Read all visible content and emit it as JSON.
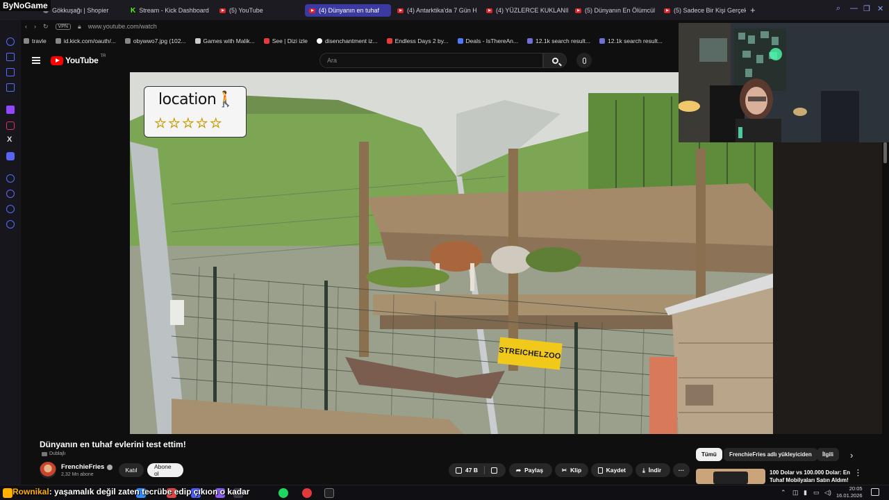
{
  "overlay": {
    "stream_logo": "ByNoGame"
  },
  "browser": {
    "tabs": [
      {
        "label": "Gökkuşağı | Shopier",
        "icon": "shopier-icon"
      },
      {
        "label": "Stream - Kick Dashboard",
        "icon": "kick-icon"
      },
      {
        "label": "(5) YouTube",
        "icon": "youtube-icon"
      },
      {
        "label": "(4) Dünyanın en tuhaf",
        "icon": "youtube-icon",
        "active": true
      },
      {
        "label": "(4) Antarktika'da 7 Gün H",
        "icon": "youtube-icon"
      },
      {
        "label": "(4) YÜZLERCE KUKLANIN",
        "icon": "youtube-icon"
      },
      {
        "label": "(5) Dünyanın En Ölümcül K",
        "icon": "youtube-icon"
      },
      {
        "label": "(5) Sadece Bir Kişi Gerçek",
        "icon": "youtube-icon"
      }
    ],
    "new_tab": "+",
    "address": {
      "vpn": "VPN",
      "url": "www.youtube.com/watch"
    },
    "bookmarks": [
      "travle",
      "id.kick.com/oauth/...",
      "obywwo7.jpg (102...",
      "Games with Malik...",
      "See | Dizi izle",
      "disenchantment iz...",
      "Endless Days 2 by...",
      "Deals - IsThereAn...",
      "12.1k search result...",
      "12.1k search result..."
    ]
  },
  "youtube": {
    "logo": "YouTube",
    "region": "TR",
    "search_placeholder": "Ara",
    "video": {
      "overlay_title": "location🚶",
      "overlay_stars": "☆☆☆☆☆",
      "sign_text": "STREICHELZOO"
    },
    "title": "Dünyanın en tuhaf evlerini test ettim!",
    "dubbed": "Dublajlı",
    "channel": {
      "name": "FrenchieFries",
      "subs": "2,32 Mn abone"
    },
    "buttons": {
      "join": "Katıl",
      "subscribe": "Abone ol",
      "likes": "47 B",
      "share": "Paylaş",
      "clip": "Klip",
      "save": "Kaydet",
      "download": "İndir",
      "more": "···"
    },
    "chips": [
      "Tümü",
      "FrenchieFries adlı yükleyiciden",
      "İlgili"
    ],
    "recommendation": {
      "title": "100 Dolar vs 100.000 Dolar: En Tuhaf Mobilyaları Satın Aldım!"
    }
  },
  "taskbar": {
    "chat_user": "Rownikal",
    "chat_message": ": yaşamalık değil zaten tecrübe edip çıkıon o kadar",
    "time": "20:05",
    "date": "16.01.2026"
  },
  "colors": {
    "yt_red": "#ff0000",
    "active_tab": "#3b3aa0",
    "kick_green": "#53fc18",
    "sign_yellow": "#f1c91b"
  }
}
